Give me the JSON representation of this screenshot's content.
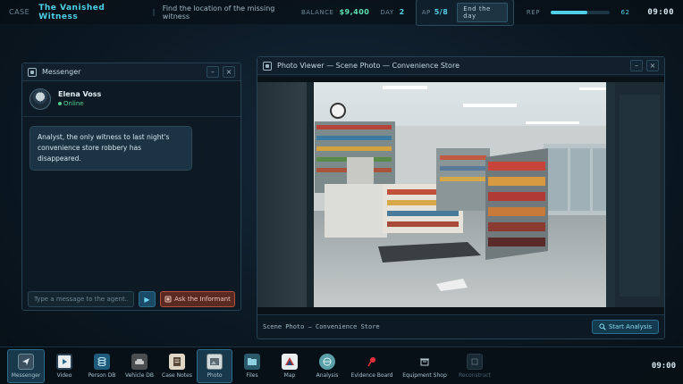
{
  "topbar": {
    "case_label": "CASE",
    "case_title": "The Vanished Witness",
    "separator": "|",
    "case_desc": "Find the location of the missing witness",
    "balance_label": "BALANCE",
    "balance_value": "$9,400",
    "day_label": "DAY",
    "day_value": "2",
    "ap_label": "AP",
    "ap_value": "5/8",
    "end_day_label": "End the day",
    "rep_label": "REP",
    "rep_value": "62",
    "rep_fraction": 0.62,
    "clock": "09:00"
  },
  "messenger": {
    "title": "Messenger",
    "minimize": "–",
    "close": "×",
    "contact_name": "Elena Voss",
    "contact_status": "Online",
    "messages": [
      "Analyst, the only witness to last night's convenience store robbery has disappeared."
    ],
    "input_placeholder": "Type a message to the agent...",
    "send_icon": "▶",
    "ask_label": "Ask the Informant"
  },
  "photo_viewer": {
    "title": "Photo Viewer — Scene Photo — Convenience Store",
    "minimize": "–",
    "close": "×",
    "caption": "Scene Photo — Convenience Store",
    "analysis_label": "Start Analysis"
  },
  "taskbar": {
    "items": [
      {
        "label": "Messenger",
        "icon": "messenger-icon"
      },
      {
        "label": "Video",
        "icon": "video-icon"
      },
      {
        "label": "Person DB",
        "icon": "database-icon"
      },
      {
        "label": "Vehicle DB",
        "icon": "car-icon"
      },
      {
        "label": "Case Notes",
        "icon": "notes-icon"
      },
      {
        "label": "Photo",
        "icon": "photo-icon"
      },
      {
        "label": "Files",
        "icon": "files-icon"
      },
      {
        "label": "Map",
        "icon": "map-icon"
      },
      {
        "label": "Analysis",
        "icon": "analysis-icon"
      },
      {
        "label": "Evidence Board",
        "icon": "pin-icon"
      },
      {
        "label": "Equipment Shop",
        "icon": "shop-icon"
      },
      {
        "label": "Reconstruct",
        "icon": "reconstruct-icon"
      }
    ],
    "clock": "09:00"
  },
  "colors": {
    "accent": "#4fd0e8",
    "money": "#5fe0b0",
    "online": "#4fd090",
    "ask_button": "#b0503c"
  }
}
